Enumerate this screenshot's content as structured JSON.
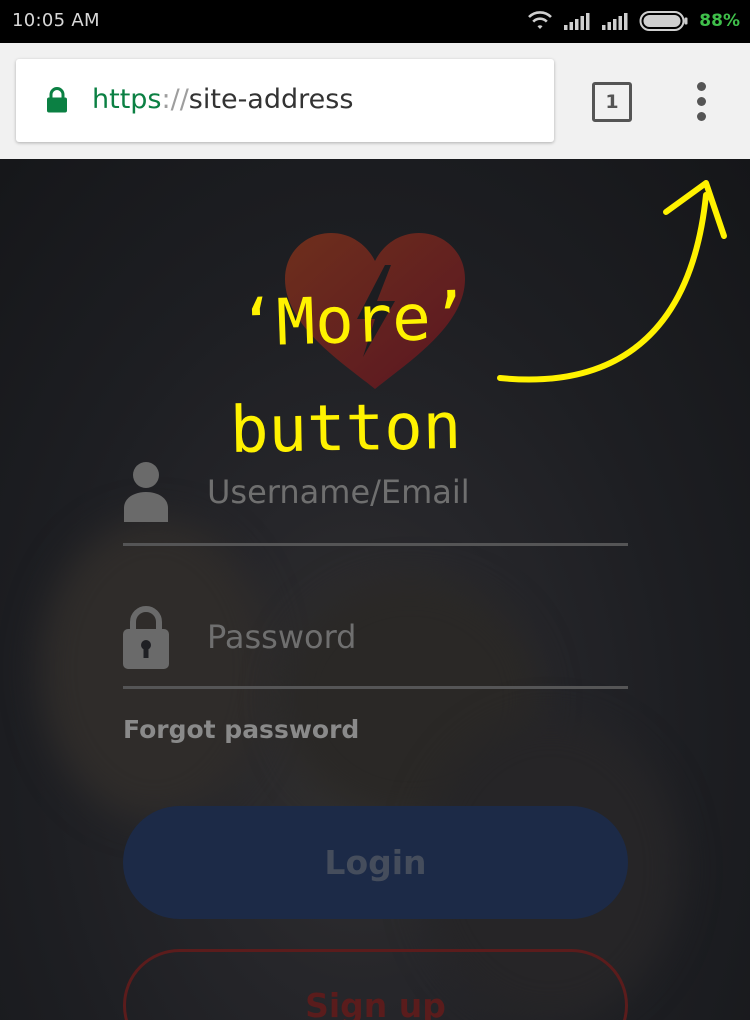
{
  "status_bar": {
    "time": "10:05 AM",
    "battery_percent": "88%",
    "icons": [
      "wifi-icon",
      "signal-icon",
      "signal-icon",
      "battery-icon"
    ]
  },
  "browser": {
    "url": {
      "scheme": "https",
      "separator": "://",
      "host": "site-address"
    },
    "tab_count": "1",
    "icons": {
      "lock": "lock-icon",
      "more": "more-vert-icon"
    },
    "colors": {
      "secure_green": "#0b8043",
      "toolbar_bg": "#f1f1f1"
    }
  },
  "login": {
    "username_placeholder": "Username/Email",
    "password_placeholder": "Password",
    "forgot_password": "Forgot password",
    "login_button": "Login",
    "signup_button": "Sign up",
    "icons": {
      "logo": "heart-logo-icon",
      "username": "user-icon",
      "password": "padlock-icon"
    }
  },
  "annotation": {
    "line1": "‘More’",
    "line2": "button",
    "color": "#fff200"
  }
}
